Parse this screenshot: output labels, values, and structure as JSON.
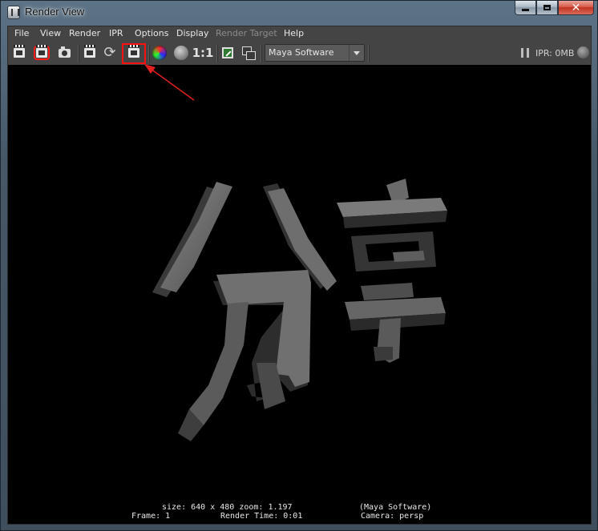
{
  "window": {
    "title": "Render View",
    "minimize": "",
    "maximize": "",
    "close": "✕"
  },
  "menubar": {
    "items": [
      {
        "label": "File",
        "enabled": true
      },
      {
        "label": "View",
        "enabled": true
      },
      {
        "label": "Render",
        "enabled": true
      },
      {
        "label": "IPR",
        "enabled": true
      },
      {
        "label": "Options",
        "enabled": true
      },
      {
        "label": "Display",
        "enabled": true
      },
      {
        "label": "Render Target",
        "enabled": false
      },
      {
        "label": "Help",
        "enabled": true
      }
    ]
  },
  "toolbar": {
    "icons": [
      "redo-render-clapper-icon",
      "render-region-clapper-icon",
      "snapshot-camera-icon",
      "ipr-render-clapper-icon",
      "refresh-ipr-icon",
      "render-sequence-clapper-icon",
      "display-rgb-channels-icon",
      "display-alpha-icon",
      "real-size-icon",
      "keep-image-icon",
      "remove-image-icon"
    ],
    "ratio_label": "1:1",
    "renderer": "Maya Software",
    "ipr_status": "IPR: 0MB",
    "highlight_color": "#ff1010"
  },
  "render": {
    "characters": [
      "分",
      "享"
    ],
    "background": "#000000",
    "info": {
      "size_zoom": "size: 640 x 480 zoom: 1.197",
      "renderer": "(Maya Software)",
      "frame": "Frame: 1",
      "render_time": "Render Time: 0:01",
      "camera": "Camera: persp"
    }
  },
  "annotation": {
    "arrow_color": "#e02020"
  }
}
